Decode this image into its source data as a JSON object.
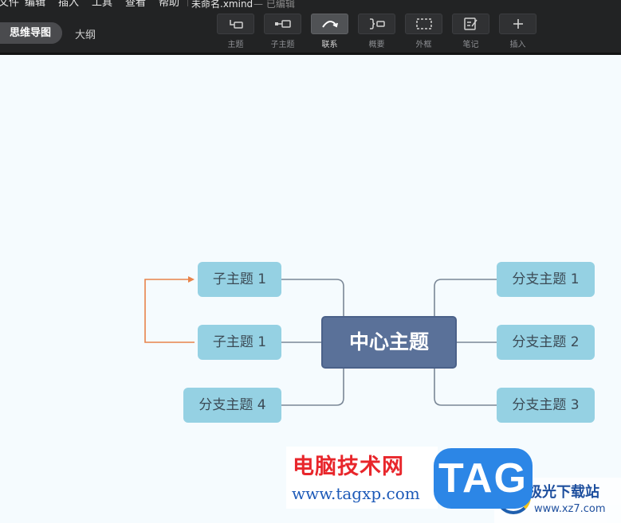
{
  "menu": {
    "items": [
      "文件",
      "编辑",
      "插入",
      "工具",
      "查看",
      "帮助"
    ],
    "file_title": "未命名.xmind",
    "file_status": "— 已编辑"
  },
  "view_tabs": {
    "active": "思维导图",
    "other": "大纲"
  },
  "toolbar": [
    {
      "label": "主题",
      "icon": "topic-icon"
    },
    {
      "label": "子主题",
      "icon": "subtopic-icon"
    },
    {
      "label": "联系",
      "icon": "relationship-icon",
      "active": true
    },
    {
      "label": "概要",
      "icon": "summary-icon"
    },
    {
      "label": "外框",
      "icon": "boundary-icon"
    },
    {
      "label": "笔记",
      "icon": "note-icon"
    },
    {
      "label": "插入",
      "icon": "plus-icon"
    }
  ],
  "mindmap": {
    "central": "中心主题",
    "left": [
      "子主题 1",
      "子主题 1",
      "分支主题 4"
    ],
    "right": [
      "分支主题 1",
      "分支主题 2",
      "分支主题 3"
    ]
  },
  "colors": {
    "topbar": "#222324",
    "canvas": "#f5fbfe",
    "central_topic": "#5a7199",
    "branch_topic": "#95d1e3",
    "connector": "#7a8796",
    "relationship": "#e8834a"
  },
  "watermark": {
    "cn": "电脑技术网",
    "url": "www.tagxp.com",
    "tag": "TAG",
    "site_cn": "极光下载站",
    "site_url": "www.xz7.com"
  }
}
